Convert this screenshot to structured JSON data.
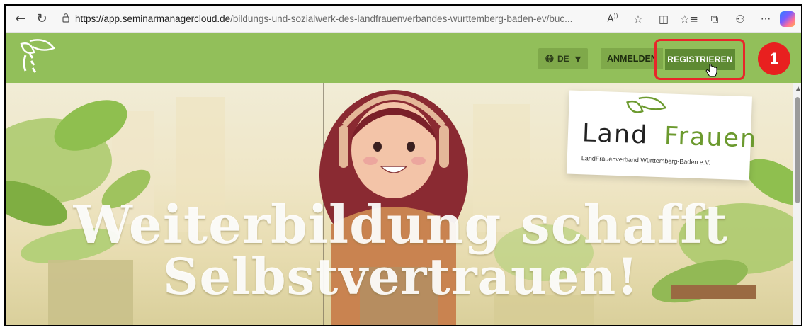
{
  "browser": {
    "url_host": "https://app.seminarmanagercloud.de",
    "url_path": "/bildungs-und-sozialwerk-des-landfrauenverbandes-wurttemberg-baden-ev/buc...",
    "icons": [
      "back-icon",
      "refresh-icon",
      "lock-icon",
      "read-aloud-icon",
      "favorite-icon",
      "split-screen-icon",
      "favorites-icon",
      "collections-icon",
      "extensions-icon",
      "more-icon",
      "copilot-icon"
    ]
  },
  "header": {
    "language": "DE",
    "login_label": "ANMELDEN",
    "register_label": "REGISTRIEREN",
    "bg_color": "#92bf5a",
    "register_color": "#5e8a33"
  },
  "annotation": {
    "step_number": "1",
    "color": "#e8201f"
  },
  "hero": {
    "logo_land": "Land",
    "logo_frauen": "Frauen",
    "logo_subtitle": "LandFrauenverband Württemberg-Baden e.V.",
    "headline_line1": "Weiterbildung schafft",
    "headline_line2": "Selbstvertrauen!"
  }
}
